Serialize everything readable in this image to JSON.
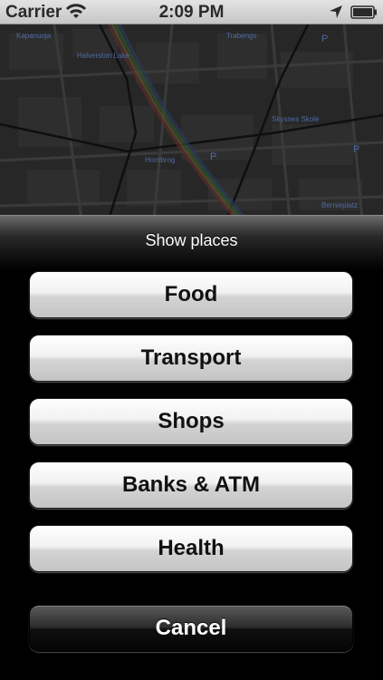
{
  "status_bar": {
    "carrier": "Carrier",
    "time": "2:09 PM",
    "icons": [
      "wifi-icon",
      "location-icon",
      "battery-icon"
    ]
  },
  "map": {
    "labels": [
      "Kapanuoja",
      "Halverston Lake",
      "Trabengs",
      "Skysnes Skole",
      "Hornbrog",
      "Bernieplatz",
      "P",
      "P",
      "P"
    ]
  },
  "action_sheet": {
    "title": "Show places",
    "buttons": [
      {
        "label": "Food"
      },
      {
        "label": "Transport"
      },
      {
        "label": "Shops"
      },
      {
        "label": "Banks & ATM"
      },
      {
        "label": "Health"
      }
    ],
    "cancel_label": "Cancel"
  },
  "colors": {
    "status_bar": "#d0d0d0",
    "sheet_background": "#000000",
    "light_button": "#e6e6e6",
    "cancel_button": "#1e1e1e"
  }
}
